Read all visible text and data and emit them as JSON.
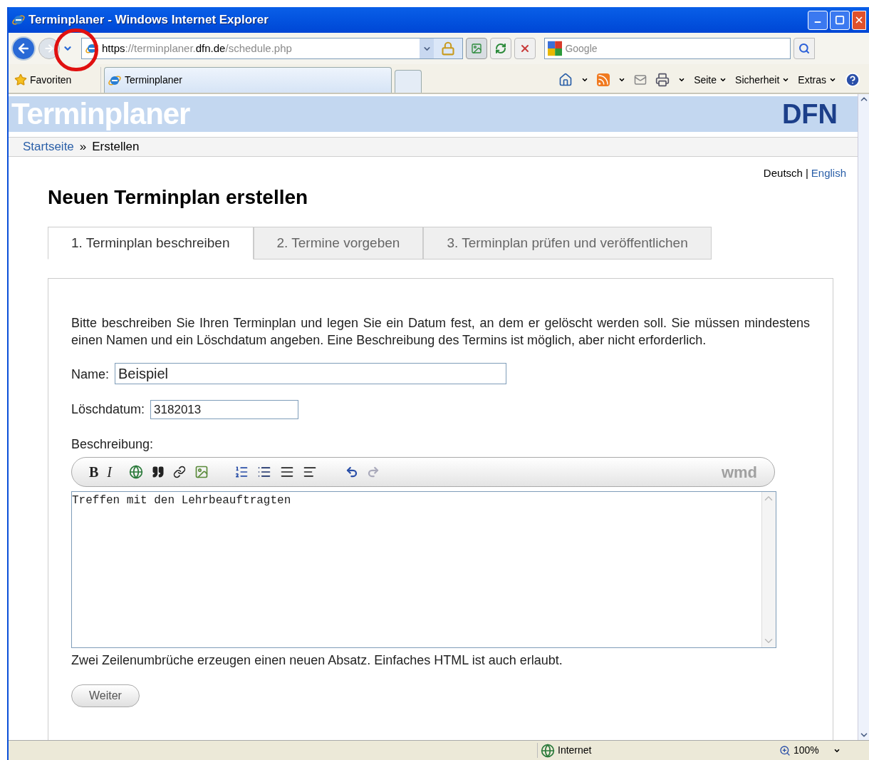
{
  "window": {
    "title": "Terminplaner - Windows Internet Explorer"
  },
  "address_bar": {
    "url_parts": [
      {
        "text": "https",
        "strong": true
      },
      {
        "text": "://terminplaner.",
        "strong": false
      },
      {
        "text": "dfn.de",
        "strong": true
      },
      {
        "text": "/schedule.php",
        "strong": false
      }
    ]
  },
  "search": {
    "placeholder": "Google"
  },
  "favorites": {
    "label": "Favoriten"
  },
  "browser_tabs": [
    {
      "label": "Terminplaner",
      "selected": true
    }
  ],
  "command_bar": [
    "Seite",
    "Sicherheit",
    "Extras"
  ],
  "page": {
    "logo": "Terminplaner",
    "brand": "DFN",
    "breadcrumb": [
      {
        "text": "Startseite",
        "kind": "link"
      },
      {
        "text": "»",
        "kind": "separator"
      },
      {
        "text": "Erstellen",
        "kind": "current"
      }
    ],
    "languages": [
      {
        "text": "Deutsch",
        "kind": "current"
      },
      {
        "text": "|",
        "kind": "separator"
      },
      {
        "text": "English",
        "kind": "link"
      }
    ],
    "heading": "Neuen Terminplan erstellen",
    "steps": [
      {
        "label": "1. Terminplan beschreiben",
        "selected": true
      },
      {
        "label": "2. Termine vorgeben",
        "selected": false
      },
      {
        "label": "3. Terminplan prüfen und veröffentlichen",
        "selected": false
      }
    ],
    "intro": "Bitte beschreiben Sie Ihren Terminplan und legen Sie ein Datum fest, an dem er gelöscht werden soll. Sie müssen mindestens einen Namen und ein Löschdatum angeben. Eine Beschreibung des Termins ist möglich, aber nicht erforderlich.",
    "name_field": {
      "label": "Name:",
      "value": "Beispiel"
    },
    "date_field": {
      "label": "Löschdatum:",
      "value": "3182013"
    },
    "description": {
      "label": "Beschreibung:",
      "format_buttons": [
        "B",
        "I"
      ],
      "editor_brand": "wmd",
      "value": "Treffen mit den Lehrbeauftragten",
      "hint": "Zwei Zeilenumbrüche erzeugen einen neuen Absatz. Einfaches HTML ist auch erlaubt."
    },
    "submit": "Weiter"
  },
  "status_bar": {
    "zone": "Internet",
    "zoom": "100%"
  }
}
